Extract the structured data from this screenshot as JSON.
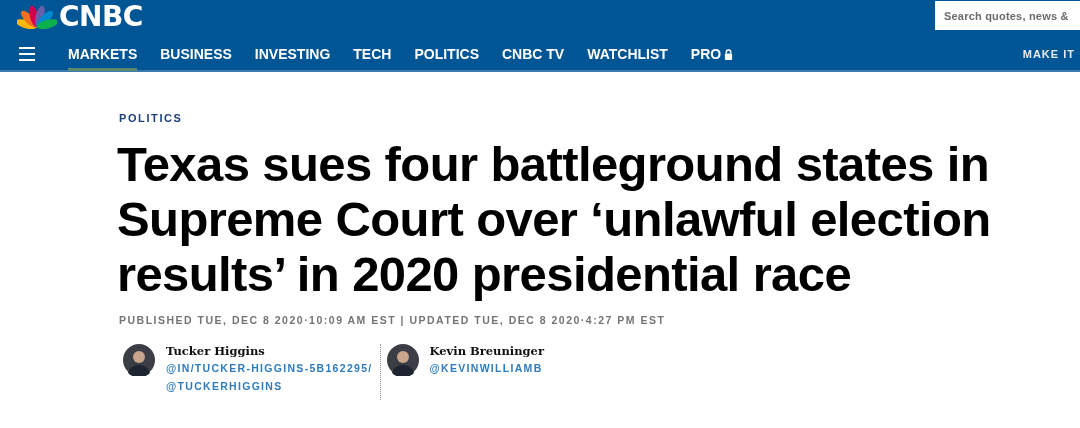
{
  "header": {
    "logo_text": "CNBC",
    "search": {
      "placeholder": "Search quotes, news &"
    },
    "nav": [
      {
        "label": "MARKETS",
        "selected": true
      },
      {
        "label": "BUSINESS",
        "selected": false
      },
      {
        "label": "INVESTING",
        "selected": false
      },
      {
        "label": "TECH",
        "selected": false
      },
      {
        "label": "POLITICS",
        "selected": false
      },
      {
        "label": "CNBC TV",
        "selected": false
      },
      {
        "label": "WATCHLIST",
        "selected": false
      },
      {
        "label": "PRO",
        "selected": false,
        "locked": true
      }
    ],
    "right_link": "MAKE IT"
  },
  "article": {
    "section": "POLITICS",
    "headline": "Texas sues four battleground states in Supreme Court over ‘unlawful election results’ in 2020 presidential race",
    "timestamp": "PUBLISHED TUE, DEC 8 2020·10:09 AM EST | UPDATED TUE, DEC 8 2020·4:27 PM EST",
    "authors": [
      {
        "name": "Tucker Higgins",
        "handles": [
          "@IN/TUCKER-HIGGINS-5B162295/",
          "@TUCKERHIGGINS"
        ]
      },
      {
        "name": "Kevin Breuninger",
        "handles": [
          "@KEVINWILLIAMB"
        ]
      }
    ]
  }
}
